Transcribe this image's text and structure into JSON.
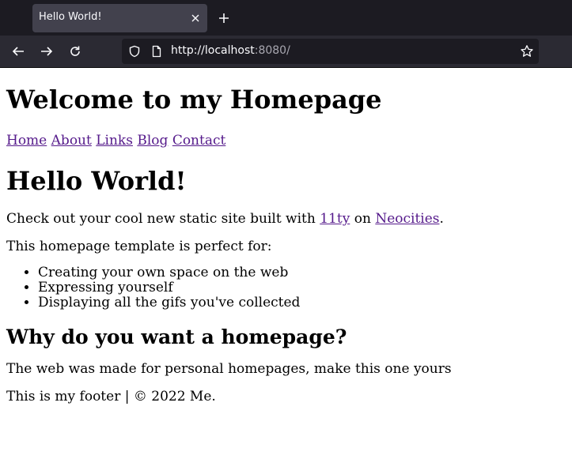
{
  "browser": {
    "tab_title": "Hello World!",
    "url_host": "http://localhost",
    "url_rest": ":8080/"
  },
  "icons": {
    "tab_close": "close-icon",
    "new_tab": "plus-icon",
    "back": "arrow-left-icon",
    "forward": "arrow-right-icon",
    "reload": "reload-icon",
    "shield": "shield-icon",
    "page": "page-icon",
    "bookmark": "star-icon"
  },
  "page": {
    "site_title": "Welcome to my Homepage",
    "nav": [
      "Home",
      "About",
      "Links",
      "Blog",
      "Contact"
    ],
    "heading": "Hello World!",
    "intro_before": "Check out your cool new static site built with ",
    "link_11ty": "11ty",
    "intro_middle": " on ",
    "link_neocities": "Neocities",
    "intro_after": ".",
    "perfect_for": "This homepage template is perfect for:",
    "list": [
      "Creating your own space on the web",
      "Expressing yourself",
      "Displaying all the gifs you've collected"
    ],
    "subheading": "Why do you want a homepage?",
    "body": "The web was made for personal homepages, make this one yours",
    "footer": "This is my footer | © 2022 Me."
  },
  "colors": {
    "link": "#551a8b",
    "chrome_dark": "#1c1b22",
    "chrome_tab": "#42414d",
    "chrome_toolbar": "#2b2a33"
  }
}
